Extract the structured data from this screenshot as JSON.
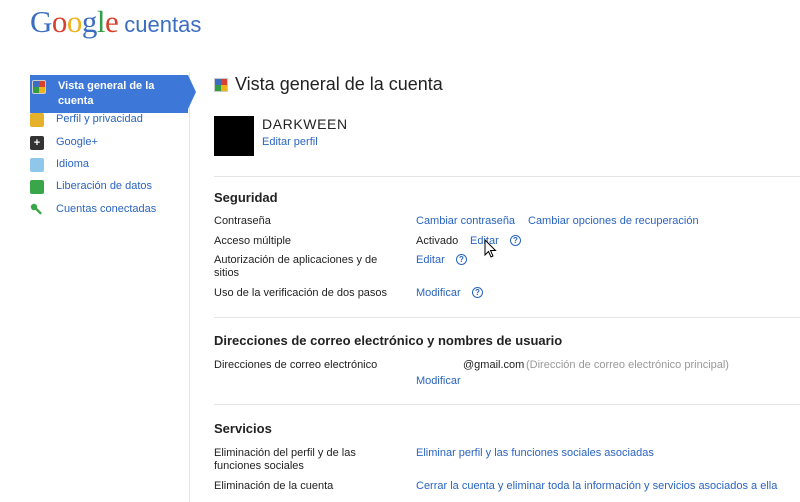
{
  "header": {
    "logo_letters": [
      {
        "char": "G",
        "color": "#3b6ec0"
      },
      {
        "char": "o",
        "color": "#d8402f"
      },
      {
        "char": "o",
        "color": "#efb21a"
      },
      {
        "char": "g",
        "color": "#3b6ec0"
      },
      {
        "char": "l",
        "color": "#2f9e44"
      },
      {
        "char": "e",
        "color": "#d8402f"
      }
    ],
    "product": "cuentas"
  },
  "sidebar": {
    "items": [
      {
        "label": "Vista general de la cuenta",
        "icon": "google-multicolor-icon",
        "active": true
      },
      {
        "label": "Perfil y privacidad",
        "icon": "lock-icon"
      },
      {
        "label": "Google+",
        "icon": "google-plus-icon"
      },
      {
        "label": "Idioma",
        "icon": "language-icon"
      },
      {
        "label": "Liberación de datos",
        "icon": "data-liberation-icon"
      },
      {
        "label": "Cuentas conectadas",
        "icon": "key-icon"
      }
    ]
  },
  "main": {
    "title": "Vista general de la cuenta",
    "profile": {
      "username": "DARKWEEN",
      "edit_label": "Editar perfil"
    },
    "security": {
      "title": "Seguridad",
      "password_label": "Contraseña",
      "change_password": "Cambiar contraseña",
      "change_recovery": "Cambiar opciones de recuperación",
      "multi_login_label": "Acceso múltiple",
      "multi_login_status": "Activado",
      "multi_login_edit": "Editar",
      "app_auth_label": "Autorización de aplicaciones y de sitios",
      "app_auth_edit": "Editar",
      "two_step_label": "Uso de la verificación de dos pasos",
      "two_step_edit": "Modificar"
    },
    "emails": {
      "title": "Direcciones de correo electrónico y nombres de usuario",
      "addresses_label": "Direcciones de correo electrónico",
      "address": "@gmail.com",
      "address_note": "(Dirección de correo electrónico principal)",
      "modify": "Modificar"
    },
    "services": {
      "title": "Servicios",
      "profile_removal_label": "Eliminación del perfil y de las funciones sociales",
      "profile_removal_action": "Eliminar perfil y las funciones sociales asociadas",
      "account_removal_label": "Eliminación de la cuenta",
      "account_removal_action": "Cerrar la cuenta y eliminar toda la información y servicios asociados a ella"
    },
    "help_glyph": "?"
  },
  "colors": {
    "link": "#2a64c0",
    "active_nav": "#3d78d8",
    "divider": "#e5e5e5"
  }
}
